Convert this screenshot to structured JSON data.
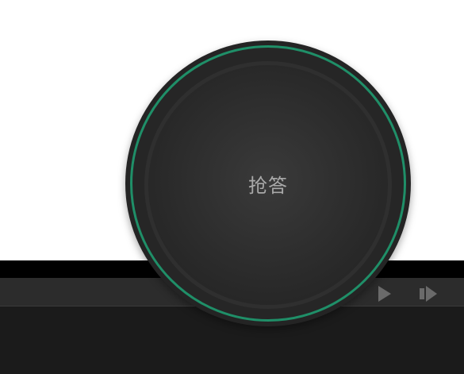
{
  "buzzer": {
    "label": "抢答",
    "ring_color": "#1f8f68"
  },
  "player_controls": {
    "play_icon": "play-icon",
    "next_icon": "next-icon",
    "icon_color": "#6a6a6a"
  },
  "colors": {
    "background": "#ffffff",
    "panel": "#1b1b1b",
    "band": "#000000",
    "toolbar": "#2c2c2c"
  }
}
